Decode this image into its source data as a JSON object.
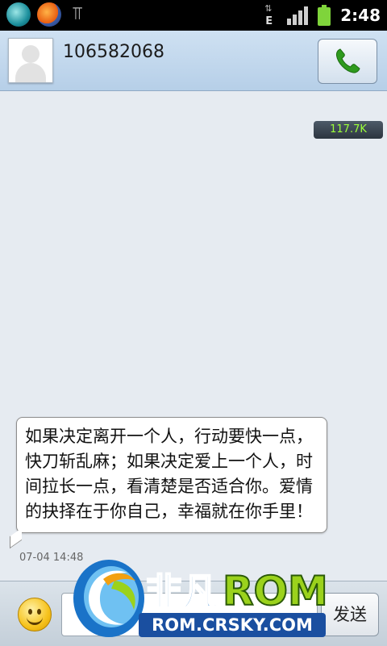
{
  "status_bar": {
    "time": "2:48",
    "network_type": "E",
    "icons": [
      "app-icon",
      "app-icon",
      "usb-icon",
      "data-arrows-icon",
      "signal-icon",
      "battery-icon"
    ]
  },
  "header": {
    "contact_number": "106582068",
    "avatar": "default-contact-avatar",
    "call_icon": "phone-icon"
  },
  "conversation": {
    "message_size": "117.7K",
    "message": {
      "text": "如果决定离开一个人，行动要快一点，快刀斩乱麻；如果决定爱上一个人，时间拉长一点，看清楚是否适合你。爱情的抉择在于你自己，幸福就在你手里！",
      "timestamp": "07-04 14:48"
    }
  },
  "input_bar": {
    "emoji_icon": "smiley-icon",
    "send_label": "发送"
  },
  "watermark": {
    "brand_cn": "非凡",
    "brand_en": "ROM",
    "url": "ROM.CRSKY.COM"
  },
  "colors": {
    "status_bar_bg": "#000000",
    "header_bg": "#c3d8ee",
    "conversation_bg": "#e6ebf1",
    "size_badge_text": "#9cff3a",
    "call_icon": "#2e9a1e",
    "watermark_green": "#9bd21c",
    "watermark_blue": "#1a73c8"
  }
}
